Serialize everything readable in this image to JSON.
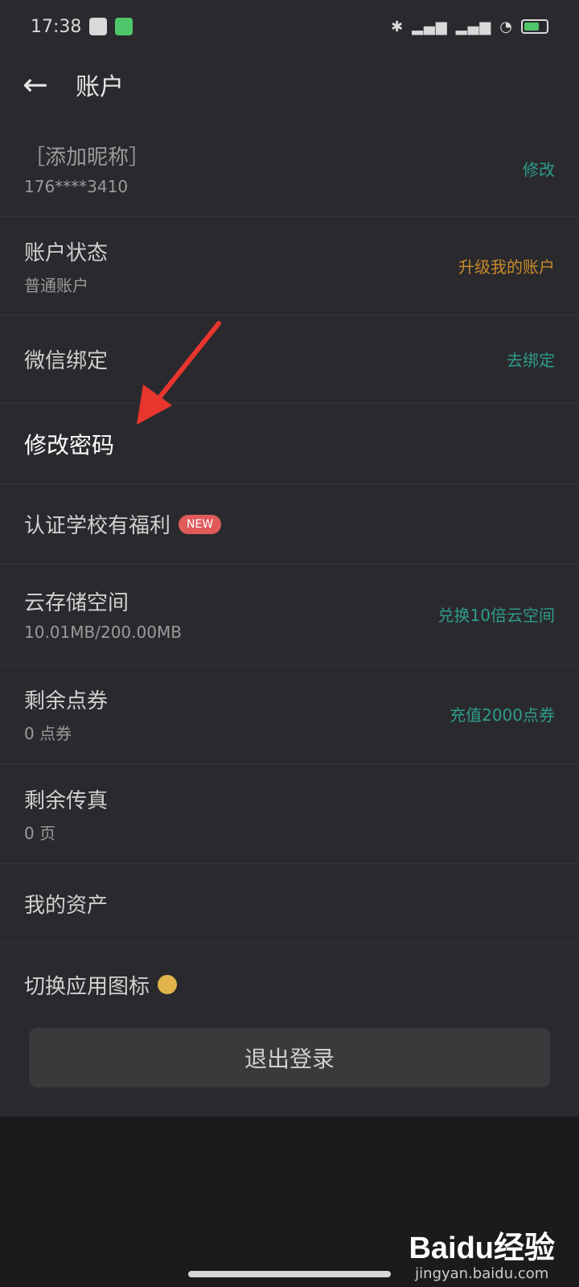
{
  "status": {
    "time": "17:38"
  },
  "header": {
    "title": "账户"
  },
  "profile": {
    "nickname": "［添加昵称］",
    "phone": "176****3410",
    "action": "修改"
  },
  "rows": [
    {
      "label": "账户状态",
      "sub": "普通账户",
      "action": "升级我的账户",
      "action_color": "#c98b2a"
    },
    {
      "label": "微信绑定",
      "action": "去绑定",
      "action_color": "#2e9c8a"
    },
    {
      "label": "修改密码"
    },
    {
      "label": "认证学校有福利",
      "badge": "NEW"
    },
    {
      "label": "云存储空间",
      "sub": "10.01MB/200.00MB",
      "action": "兑换10倍云空间",
      "action_color": "#2e9c8a"
    },
    {
      "label": "剩余点券",
      "sub": "0 点券",
      "action": "充值2000点券",
      "action_color": "#2e9c8a"
    },
    {
      "label": "剩余传真",
      "sub": "0 页"
    },
    {
      "label": "我的资产"
    },
    {
      "label": "切换应用图标"
    }
  ],
  "logout": {
    "label": "退出登录"
  },
  "watermark": {
    "logo": "Baidu经验",
    "url": "jingyan.baidu.com"
  },
  "colors": {
    "background": "#2a2a2e",
    "teal": "#2e9c8a",
    "orange": "#c98b2a",
    "badge": "#e05a5a",
    "arrow": "#e8352e"
  }
}
